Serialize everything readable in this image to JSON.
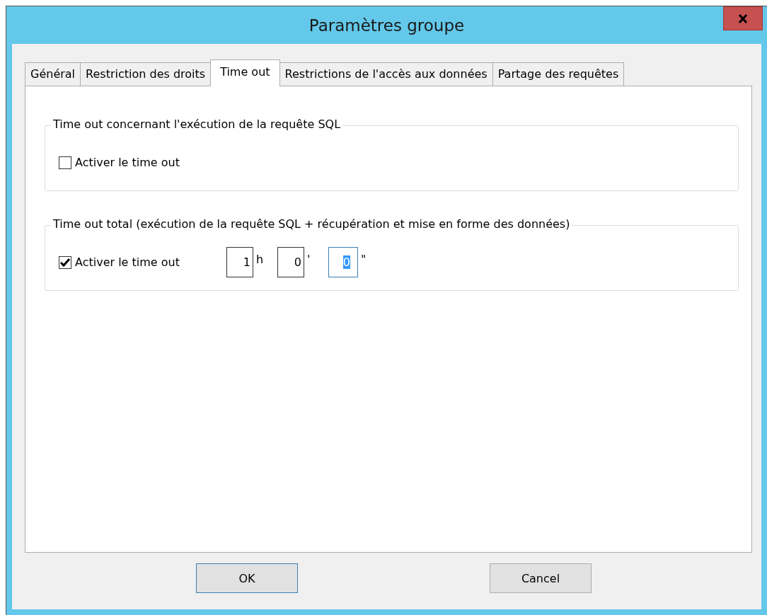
{
  "window": {
    "title": "Paramètres groupe"
  },
  "tabs": [
    {
      "label": "Général",
      "selected": false
    },
    {
      "label": "Restriction des droits",
      "selected": false
    },
    {
      "label": "Time out",
      "selected": true
    },
    {
      "label": "Restrictions de l'accès aux données",
      "selected": false
    },
    {
      "label": "Partage des requêtes",
      "selected": false
    }
  ],
  "groups": [
    {
      "legend": "Time out concernant l'exécution de la requête SQL",
      "checkbox": {
        "label": "Activer le time out",
        "checked": false
      }
    },
    {
      "legend": "Time out total (exécution de la requête SQL + récupération et mise en forme des données)",
      "checkbox": {
        "label": "Activer le time out",
        "checked": true
      },
      "fields": [
        {
          "value": "1",
          "unit": "h",
          "focused": false
        },
        {
          "value": "0",
          "unit": "'",
          "focused": false
        },
        {
          "value": "0",
          "unit": "\"",
          "focused": true
        }
      ]
    }
  ],
  "buttons": [
    {
      "label": "OK",
      "default": true
    },
    {
      "label": "Cancel",
      "default": false
    }
  ]
}
